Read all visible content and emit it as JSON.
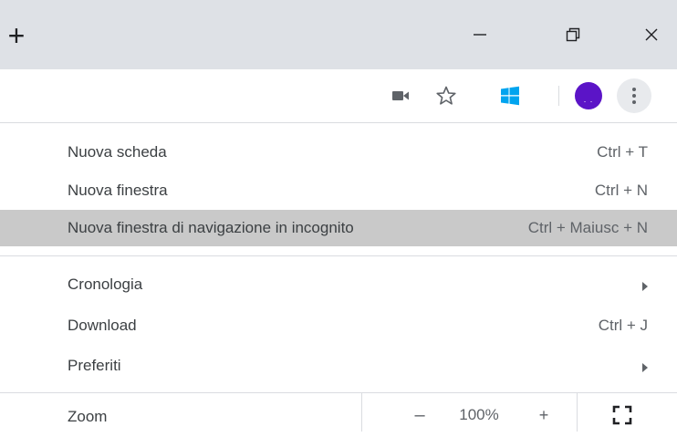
{
  "titlebar": {
    "new_tab_label": "+",
    "icons": [
      "minimize-icon",
      "restore-icon",
      "close-icon"
    ]
  },
  "toolbar": {
    "icons": [
      "camera-icon",
      "star-icon",
      "windows-icon",
      "avatar",
      "more-menu-icon"
    ],
    "avatar_color": "#5b14c7",
    "avatar_text": ". ."
  },
  "menu": {
    "items": [
      {
        "label": "Nuova scheda",
        "shortcut": "Ctrl + T"
      },
      {
        "label": "Nuova finestra",
        "shortcut": "Ctrl + N"
      },
      {
        "label": "Nuova finestra di navigazione in incognito",
        "shortcut": "Ctrl + Maiusc + N",
        "highlighted": true
      },
      {
        "label": "Cronologia",
        "submenu": true
      },
      {
        "label": "Download",
        "shortcut": "Ctrl + J"
      },
      {
        "label": "Preferiti",
        "submenu": true
      }
    ],
    "zoom": {
      "label": "Zoom",
      "minus": "–",
      "value": "100%",
      "plus": "+"
    }
  },
  "colors": {
    "titlebar_bg": "#dee1e6",
    "highlight_bg": "#c9c9c9",
    "separator": "#dadce0"
  }
}
